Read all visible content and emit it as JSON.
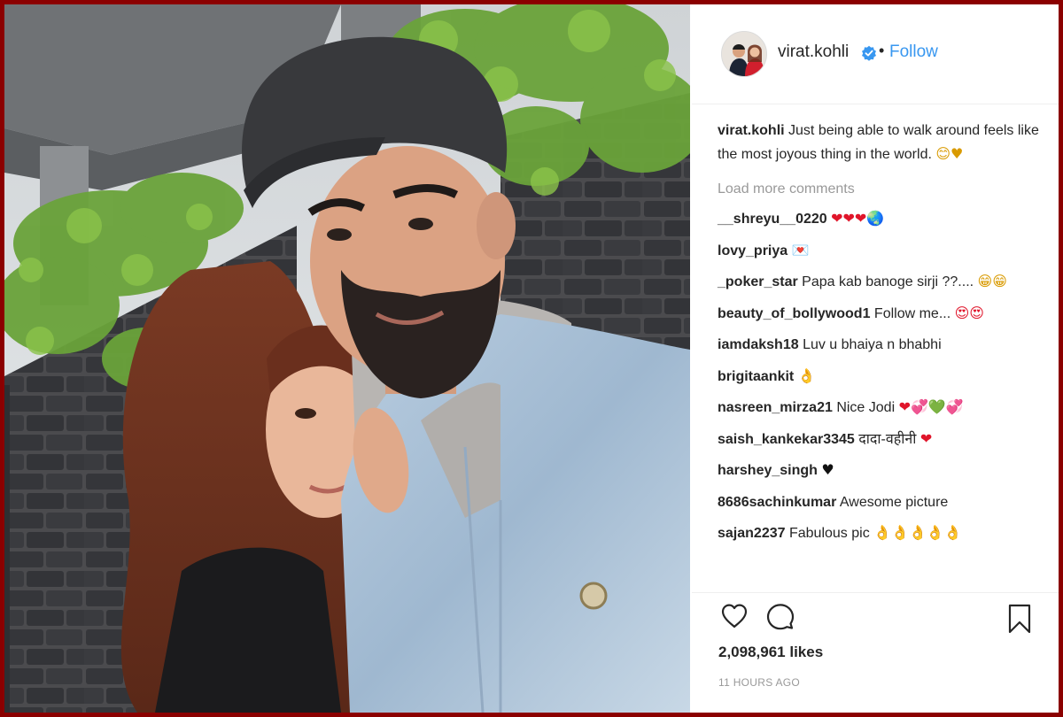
{
  "post": {
    "author": "virat.kohli",
    "follow_label": "Follow",
    "separator": "•",
    "caption_text": "Just being able to walk around feels like the most joyous thing in the world.",
    "caption_emoji": "😊♥",
    "load_more_label": "Load more comments",
    "likes": "2,098,961 likes",
    "timestamp": "11 HOURS AGO"
  },
  "comments": [
    {
      "user": "__shreyu__0220",
      "text": "",
      "emoji": "❤❤❤🌏"
    },
    {
      "user": "lovy_priya",
      "text": "",
      "emoji": "💌"
    },
    {
      "user": "_poker_star",
      "text": "Papa kab banoge sirji ??....",
      "emoji": "😁😁"
    },
    {
      "user": "beauty_of_bollywood1",
      "text": "Follow me...",
      "emoji": "😍😍"
    },
    {
      "user": "iamdaksh18",
      "text": "Luv u bhaiya n bhabhi",
      "emoji": ""
    },
    {
      "user": "brigitaankit",
      "text": "",
      "emoji": "👌"
    },
    {
      "user": "nasreen_mirza21",
      "text": "Nice Jodi",
      "emoji": "❤💞💚💞"
    },
    {
      "user": "saish_kankekar3345",
      "text": "दादा-वहीनी",
      "emoji": "❤"
    },
    {
      "user": "harshey_singh",
      "text": "",
      "emoji": "♥"
    },
    {
      "user": "8686sachinkumar",
      "text": "Awesome picture",
      "emoji": ""
    },
    {
      "user": "sajan2237",
      "text": "Fabulous pic",
      "emoji": "👌👌👌👌👌"
    }
  ],
  "icons": {
    "like": "heart-icon",
    "comment": "comment-bubble-icon",
    "save": "bookmark-icon",
    "verified": "verified-badge-icon"
  },
  "colors": {
    "frame": "#8b0000",
    "link": "#3897f0",
    "verified": "#3897f0",
    "muted": "#999999",
    "text": "#262626"
  }
}
